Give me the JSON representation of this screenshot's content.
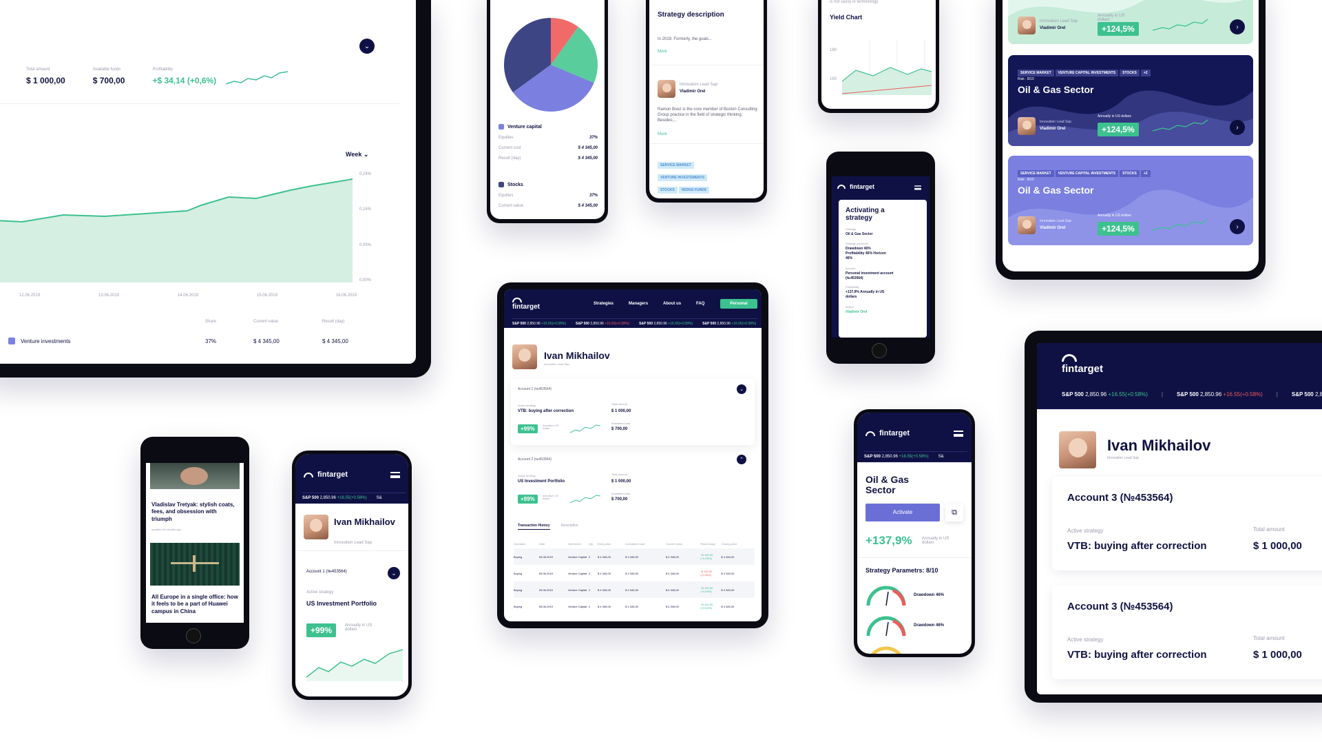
{
  "brand": {
    "name": "fintarget",
    "accent": "#3cc18f",
    "navy": "#0f1145",
    "purple": "#7b80e0",
    "red": "#ef5a5a"
  },
  "ticker": {
    "index": "S&P 500",
    "value": "2,850.96",
    "change_up": "+16.55(+0.58%)",
    "change_down": "+16.55(+0.58%)",
    "cut": "S&"
  },
  "tablet_left": {
    "stats": [
      {
        "label": "Total amount",
        "value": "$ 1 000,00"
      },
      {
        "label": "Available funds",
        "value": "$ 700,00"
      },
      {
        "label": "Profitability",
        "value": "+$ 34,14 (+0,6%)"
      }
    ],
    "period": "Week",
    "y_ticks": [
      "0,24%",
      "0,16%",
      "0,05%",
      "0,00%"
    ],
    "x_ticks": [
      "12.06.2019",
      "13.06.2019",
      "14.06.2019",
      "15.06.2019",
      "16.06.2019"
    ],
    "table_headers": [
      "Share",
      "Current value",
      "Result (day)"
    ],
    "row": {
      "name": "Venture investments",
      "share": "37%",
      "value": "$ 4 345,00",
      "result": "$ 4 345,00"
    }
  },
  "phone_pie": {
    "sections": [
      {
        "name": "Venture capital",
        "rows": [
          [
            "Equities",
            "37%"
          ],
          [
            "Current cost",
            "$ 4 345,00"
          ],
          [
            "Result (day)",
            "$ 4 345,00"
          ]
        ]
      },
      {
        "name": "Stocks",
        "rows": [
          [
            "Equities",
            "37%"
          ],
          [
            "Current value",
            "$ 4 345,00"
          ]
        ]
      }
    ]
  },
  "phone_strategy": {
    "title": "Strategy description",
    "text": "In 2019. Formerly, the goals...",
    "more": "More",
    "author_role": "Innovation Lead Sap",
    "author_name": "Vladimir Orel",
    "bio": "Ramon Boez is the core member of Boston Consulting Group practice in the field of strategic thinking. Besides,...",
    "more2": "More",
    "tags": [
      "SERVICE MARKET",
      "VENTURE INVESTEMENTS",
      "STOCKS",
      "HEDGE FUNDS"
    ]
  },
  "phone_yield": {
    "intro": "is not savvy in terminology",
    "title": "Yield Chart",
    "ticks": [
      "180",
      "160"
    ]
  },
  "phone_cards": {
    "tags": [
      "SERVICE MARKET",
      "VENTURE CAPITAL INVESTMENTS",
      "STOCKS",
      "+2"
    ],
    "risk_label": "Risk :",
    "risk_value": "8/10",
    "title": "Oil & Gas Sector",
    "author_role": "Innovation Lead Sap",
    "author_name": "Vladimir Orel",
    "annual_label": "Annually in US dollars",
    "annual_value": "+124,5%"
  },
  "phone_activating": {
    "title": "Activating a strategy",
    "fields": [
      {
        "label": "Strategy",
        "value": "Oil & Gas Sector"
      },
      {
        "label": "Strategy paramets",
        "value": "Drawdown 46% Profitability 46% Horizon 46%"
      },
      {
        "label": "Account",
        "value": "Personal investment account (№453564)"
      },
      {
        "label": "Profitability",
        "value": "+137,9% Annually in US dollars"
      },
      {
        "label": "Author",
        "value": "Vladimir Orel"
      }
    ]
  },
  "phone_news": {
    "articles": [
      {
        "title": "Vladislav Tretyak: stylish coats, fees, and obsession with triumph",
        "meta": "updated 34 minutes ago"
      },
      {
        "title": "All Europe in a single office: how it feels to be a part of Huawei campus in China",
        "meta": ""
      }
    ]
  },
  "phone_profile": {
    "name": "Ivan Mikhailov",
    "role": "Innovation Lead Sap",
    "account": "Account 1 (№453564)",
    "strategy_label": "Active strategy",
    "strategy": "US Investment Portfolio",
    "pct": "+99%",
    "pct_label": "Annually in US dollars"
  },
  "tablet_center": {
    "nav": [
      "Strategies",
      "Managers",
      "About us",
      "FAQ"
    ],
    "personal": "Personal",
    "name": "Ivan Mikhailov",
    "role": "Innovation Lead Sap",
    "accounts": [
      {
        "title": "Account 1 (№453564)",
        "strategy_label": "Active strategy",
        "strategy": "VTB: buying after correction",
        "total_label": "Total amount",
        "total": "$ 1 000,00",
        "avail_label": "Available funds",
        "avail": "$ 700,00",
        "pct": "+99%",
        "pct_label": "Annually in US dollars"
      },
      {
        "title": "Account 2 (№453564)",
        "strategy_label": "Active strategy",
        "strategy": "US Investment Portfolio",
        "total_label": "Total amount",
        "total": "$ 1 000,00",
        "avail_label": "Available funds",
        "avail": "$ 700,00",
        "pct": "+99%",
        "pct_label": "Annually in US dollars"
      }
    ],
    "tabs": [
      "Transaction History",
      "Description"
    ],
    "table_headers": [
      "Operation",
      "Date",
      "Instrument",
      "Qty",
      "Entry price",
      "Investment cost",
      "Current value",
      "Result (day)",
      "Closing price"
    ],
    "rows": [
      [
        "Buying",
        "05.06.2019",
        "Venture Capital",
        "2",
        "$ 4 345,00",
        "$ 4 345,00",
        "$ 4 345,00",
        "+$ 100,00 (+0,06%)",
        "$ 4 345,00"
      ],
      [
        "Buying",
        "05.06.2019",
        "Venture Capital",
        "2",
        "$ 4 345,00",
        "$ 4 345,00",
        "$ 4 345,00",
        "-$ 100,00 (-0,06%)",
        "$ 4 345,00"
      ],
      [
        "Buying",
        "05.06.2019",
        "Venture Capital",
        "2",
        "$ 4 345,00",
        "$ 4 345,00",
        "$ 4 345,00",
        "+$ 100,00 (+0,06%)",
        "$ 4 345,00"
      ],
      [
        "Buying",
        "05.06.2019",
        "Venture Capital",
        "2",
        "$ 4 345,00",
        "$ 4 345,00",
        "$ 4 345,00",
        "+$ 100,00 (+0,06%)",
        "$ 4 345,00"
      ]
    ]
  },
  "phone_oil": {
    "title": "Oil & Gas Sector",
    "activate": "Activate",
    "pct": "+137,9%",
    "pct_label": "Annually in US dollars",
    "params": "Strategy Parametrs: 8/10",
    "gauges": [
      "Drawdown 46%",
      "Drawdown 46%"
    ]
  },
  "tablet_right": {
    "name": "Ivan Mikhailov",
    "role": "Innovation Lead Sap",
    "accounts": [
      {
        "title": "Account 3 (№453564)",
        "strategy_label": "Active strategy",
        "strategy": "VTB: buying after correction",
        "total_label": "Total amount",
        "total": "$ 1 000,00"
      },
      {
        "title": "Account 3 (№453564)",
        "strategy_label": "Active strategy",
        "strategy": "VTB: buying after correction",
        "total_label": "Total amount",
        "total": "$ 1 000,00"
      }
    ]
  }
}
